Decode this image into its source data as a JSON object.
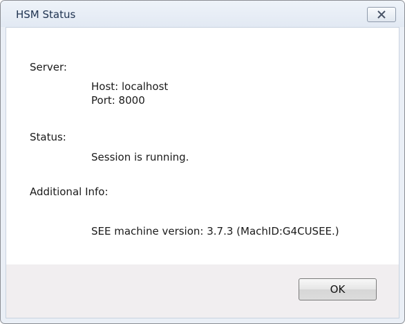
{
  "window": {
    "title": "HSM Status",
    "close_icon": "close-icon"
  },
  "server": {
    "label": "Server:",
    "host": "Host: localhost",
    "port": "Port:  8000"
  },
  "status": {
    "label": "Status:",
    "value": "Session is running."
  },
  "additional_info": {
    "label": "Additional Info:",
    "value": "SEE machine version: 3.7.3 (MachID:G4CUSEE.)"
  },
  "footer": {
    "ok_label": "OK"
  },
  "colors": {
    "title_text": "#1e3250",
    "frame": "#eaeff6",
    "footer_bg": "#f1eef0"
  }
}
